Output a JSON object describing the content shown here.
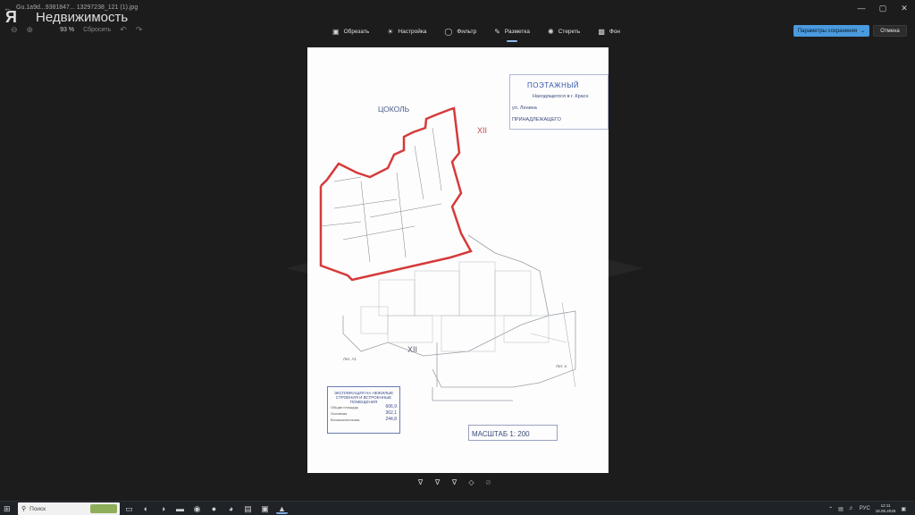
{
  "titlebar": {
    "back_glyph": "←",
    "file_name": "Gu.1a9d...9381847... 13297238_121 (1).jpg",
    "min": "—",
    "max": "▢",
    "close": "✕"
  },
  "watermark": {
    "logo": "Я",
    "text": "Недвижимость"
  },
  "view": {
    "zoom": "93 %",
    "reset": "Сбросить"
  },
  "toolbar": {
    "items": [
      {
        "label": "Обрезать",
        "icon": "crop-icon"
      },
      {
        "label": "Настройка",
        "icon": "brightness-icon"
      },
      {
        "label": "Фильтр",
        "icon": "filter-icon"
      },
      {
        "label": "Разметка",
        "icon": "markup-icon"
      },
      {
        "label": "Стереть",
        "icon": "erase-icon"
      },
      {
        "label": "Фон",
        "icon": "background-icon"
      }
    ],
    "save_label": "Параметры сохранения",
    "cancel_label": "Отмена"
  },
  "document": {
    "stamp_title": "ПОЭТАЖНЫЙ",
    "stamp_line1": "Находящегося в г. Красн",
    "stamp_street": "ул. Ленина",
    "stamp_owner": "ПРИНАДЛЕЖАЩЕГО",
    "plan_label": "ЦОКОЛЬ",
    "roman_top": "XII",
    "roman_bottom": "XII",
    "lit_left": "Лит. А1",
    "lit_right": "Лит. а",
    "scale": "МАСШТАБ 1:  200",
    "explication": {
      "heading": "ЭКСПЛИКАЦИЯ НА НЕЖИЛЫЕ СТРОЕНИЯ И ВСТРОЕННЫЕ ПОМЕЩЕНИЯ",
      "rows": [
        {
          "label": "Общая площадь",
          "value": "606,9"
        },
        {
          "label": "Основная",
          "value": "362,1"
        },
        {
          "label": "Вспомогательная",
          "value": "244,8"
        }
      ]
    }
  },
  "taskbar": {
    "search_placeholder": "Поиск",
    "tray_lang": "РУС",
    "time": "12:11",
    "date": "16.05.2026"
  },
  "colors": {
    "accent": "#4a9adf",
    "plan_outline": "#d63a3a"
  }
}
